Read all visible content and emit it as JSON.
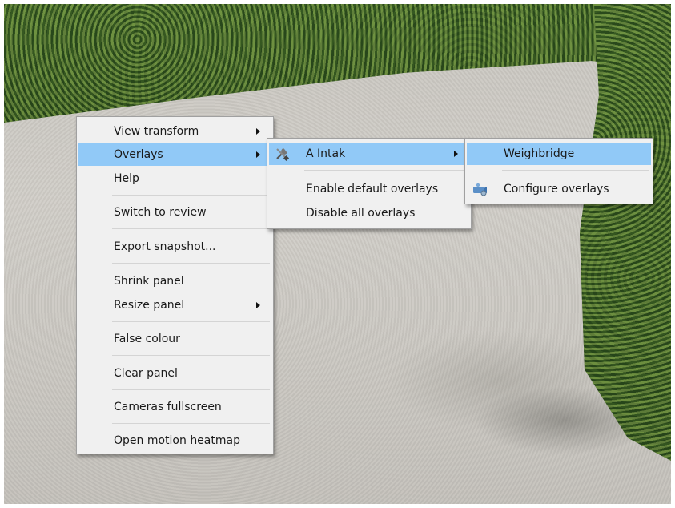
{
  "background": {
    "description_colors": {
      "gravel": "#cbc8c2",
      "hedge": "#3a6328"
    }
  },
  "context_menu": {
    "items": [
      {
        "label": "View transform",
        "has_submenu": true
      },
      {
        "label": "Overlays",
        "has_submenu": true,
        "highlighted": true
      },
      {
        "label": "Help"
      },
      {
        "label": "Switch to review"
      },
      {
        "label": "Export snapshot..."
      },
      {
        "label": "Shrink panel"
      },
      {
        "label": "Resize panel",
        "has_submenu": true
      },
      {
        "label": "False colour"
      },
      {
        "label": "Clear panel"
      },
      {
        "label": "Cameras fullscreen"
      },
      {
        "label": "Open motion heatmap"
      }
    ]
  },
  "overlays_menu": {
    "items": [
      {
        "label": "A Intak",
        "icon": "tools-icon",
        "has_submenu": true,
        "highlighted": true
      },
      {
        "label": "Enable default overlays"
      },
      {
        "label": "Disable all overlays"
      }
    ]
  },
  "intak_menu": {
    "items": [
      {
        "label": "Weighbridge",
        "highlighted": true
      },
      {
        "label": "Configure overlays",
        "icon": "camera-settings-icon"
      }
    ]
  },
  "colors": {
    "highlight": "#91c9f7",
    "menu_bg": "#f0f0f0",
    "menu_border": "#a0a0a0"
  }
}
